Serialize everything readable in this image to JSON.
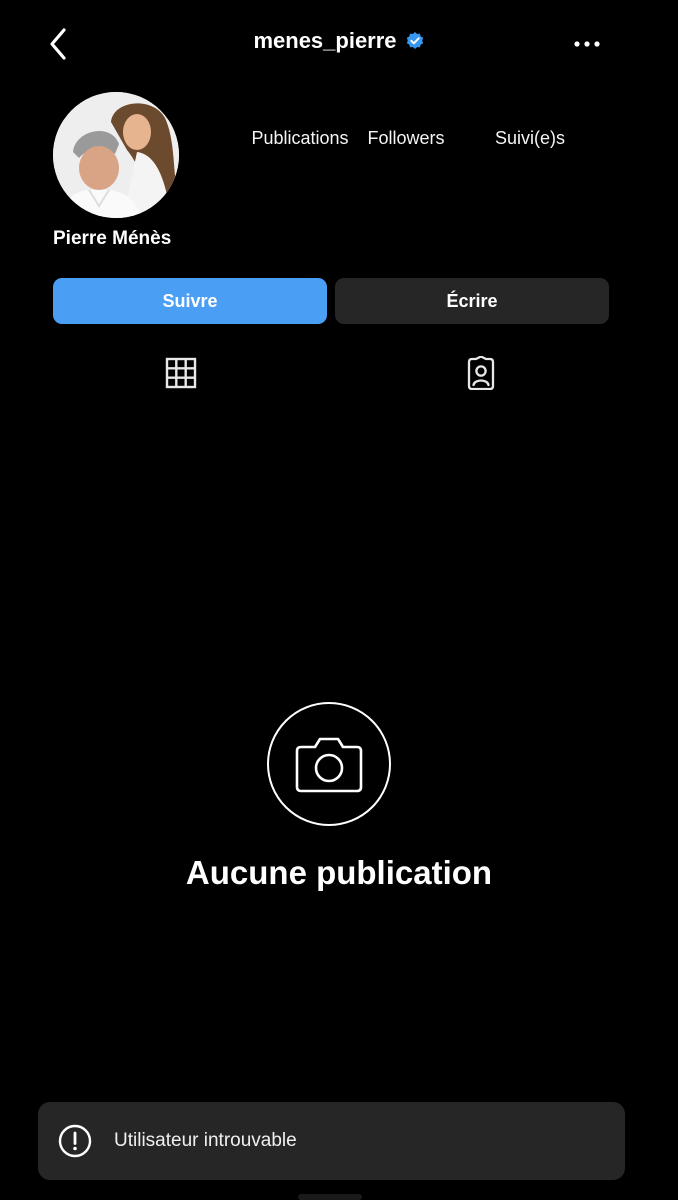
{
  "header": {
    "username": "menes_pierre",
    "verified": true,
    "icons": {
      "back": "chevron-left-icon",
      "more": "more-horizontal-icon",
      "verified": "verified-badge-icon"
    }
  },
  "profile": {
    "display_name": "Pierre Ménès",
    "stats": {
      "publications_label": "Publications",
      "followers_label": "Followers",
      "following_label": "Suivi(e)s"
    }
  },
  "actions": {
    "follow_label": "Suivre",
    "message_label": "Écrire"
  },
  "tabs": [
    {
      "icon": "grid-icon"
    },
    {
      "icon": "tagged-person-icon"
    }
  ],
  "empty_state": {
    "icon": "camera-icon",
    "text": "Aucune publication"
  },
  "toast": {
    "icon": "alert-circle-icon",
    "text": "Utilisateur introuvable"
  },
  "colors": {
    "background": "#000000",
    "accent": "#4a9ff5",
    "secondary_button": "#262626",
    "verified": "#3897f0"
  }
}
